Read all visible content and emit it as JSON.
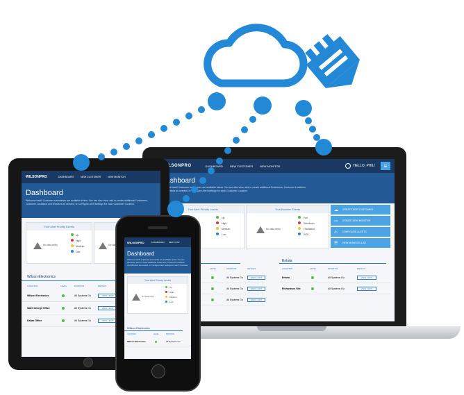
{
  "brand": "WILSONPRO",
  "laptop": {
    "nav": [
      "DASHBOARD",
      "NEW CUSTOMER",
      "NEW MONITOR"
    ],
    "user": "HELLO, PHIL!",
    "title": "Dashboard",
    "subtitle": "Welcome back! Customer summaries are available below. You can also view, add or create additional Customers, Customer Locations and Monitors as needed, or Configure Alert settings for each Customer Location.",
    "card1_title": "True Alert Priority Levels",
    "card2_title": "True Booster Events",
    "no_data": "No data entry",
    "legend1": [
      "Up",
      "High",
      "Medium",
      "Low"
    ],
    "legend2": [
      "Fail",
      "Shutdown",
      "Oscillation",
      "SOS"
    ],
    "actions": [
      "CREATE NEW CUSTOMER",
      "CREATE NEW MONITOR",
      "CONFIGURE ALERTS",
      "VIEW MONITOR LIST"
    ],
    "section1": "Electronics",
    "section2": "Entota",
    "cols": [
      "LOCATION",
      "LEVEL",
      "MONITOR",
      "DETAILS"
    ],
    "rows1": [
      {
        "name": "ectronics",
        "monitor": "All Systems Go",
        "btn": "VIEW / EDIT"
      },
      {
        "name": "e Office",
        "monitor": "All Systems Go",
        "btn": "VIEW / EDIT"
      },
      {
        "name": "ce",
        "monitor": "All Systems Go",
        "btn": "VIEW / EDIT"
      }
    ],
    "rows2": [
      {
        "name": "Entota",
        "monitor": "All Systems Go",
        "btn": "VIEW / EDIT"
      },
      {
        "name": "Richardson Site",
        "monitor": "All Systems Go",
        "btn": "VIEW / EDIT"
      }
    ]
  },
  "tablet": {
    "nav": [
      "DASHBOARD",
      "NEW CUSTOMER",
      "NEW MONITOR"
    ],
    "title": "Dashboard",
    "subtitle": "Welcome back! Customer summaries are available below. You can also view, add or create additional Customers, Customer Locations and Monitors as needed, or Configure Alert settings for each Customer Location.",
    "card1_title": "True Alert Priority Levels",
    "card2_title": "True B",
    "no_data": "No data entry",
    "no_data2": "No data",
    "legend": [
      "Up",
      "High",
      "Medium",
      "Low"
    ],
    "section": "Wilson Electronics",
    "cols": [
      "LOCATION",
      "LEVEL",
      "MONITOR",
      "DETAILS"
    ],
    "rows": [
      {
        "name": "Wilson Electronics",
        "monitor": "All Systems Go",
        "btn": "VIEW / EDIT"
      },
      {
        "name": "Saint George Office",
        "monitor": "All Systems Go",
        "btn": "VIEW / EDIT"
      },
      {
        "name": "Dallas Office",
        "monitor": "All Systems Go",
        "btn": "VIEW / EDIT"
      }
    ]
  },
  "phone": {
    "nav": [
      "DASHBOARD",
      "NEW CUST"
    ],
    "title": "Dashboard",
    "subtitle": "Welcome back! Customer summaries are available below. You can also view, add or create additional Customers, Customer Locations and Monitors as needed, or Configure Alert settings for each Customer Location.",
    "card_title": "True Alert Priority Levels",
    "no_data": "No data entry",
    "legend": [
      "Up",
      "High",
      "Medium",
      "Low"
    ],
    "section": "Wilson Electronics",
    "cols": [
      "LOCATION",
      "LEVEL",
      "MONITOR"
    ],
    "rows": [
      {
        "name": "Wilson Electronics",
        "monitor": "All Systems Go"
      }
    ]
  },
  "colors": {
    "accent": "#2389d6",
    "navy": "#1a3a63",
    "hero": "#235a95",
    "green": "#58b947",
    "red": "#d83a3a",
    "yellow": "#f2c230",
    "blue": "#2f82d6"
  }
}
